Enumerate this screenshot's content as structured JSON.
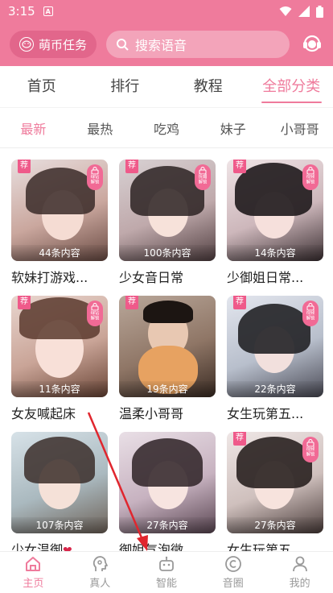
{
  "status": {
    "time": "3:15",
    "app_badge": "A"
  },
  "header": {
    "coin_label": "萌币任务",
    "search_placeholder": "搜索语音"
  },
  "main_tabs": [
    {
      "label": "首页"
    },
    {
      "label": "排行"
    },
    {
      "label": "教程"
    },
    {
      "label": "全部分类"
    }
  ],
  "sub_tabs": [
    {
      "label": "最新"
    },
    {
      "label": "最热"
    },
    {
      "label": "吃鸡"
    },
    {
      "label": "妹子"
    },
    {
      "label": "小哥哥"
    }
  ],
  "badges": {
    "recommend": "荐"
  },
  "cards": [
    {
      "title": "软妹打游戏...",
      "count": "44条内容",
      "lock": "绿钻 解锁"
    },
    {
      "title": "少女音日常",
      "count": "100条内容",
      "lock": "抚媚 解锁"
    },
    {
      "title": "少御姐日常...",
      "count": "14条内容",
      "lock": "视频 解锁"
    },
    {
      "title": "女友喊起床",
      "count": "11条内容",
      "lock": "绿钻 解锁"
    },
    {
      "title": "温柔小哥哥",
      "count": "19条内容",
      "lock": ""
    },
    {
      "title": "女生玩第五...",
      "count": "22条内容",
      "lock": "视频 解锁"
    },
    {
      "title": "少女温御",
      "count": "107条内容",
      "lock": ""
    },
    {
      "title": "御姐气泡微...",
      "count": "27条内容",
      "lock": ""
    },
    {
      "title": "女生玩第五...",
      "count": "27条内容",
      "lock": "视频 解锁"
    }
  ],
  "bottom_nav": [
    {
      "label": "主页"
    },
    {
      "label": "真人"
    },
    {
      "label": "智能"
    },
    {
      "label": "音圈"
    },
    {
      "label": "我的"
    }
  ],
  "colors": {
    "accent": "#ef7b9c",
    "arrow": "#e0262e"
  }
}
